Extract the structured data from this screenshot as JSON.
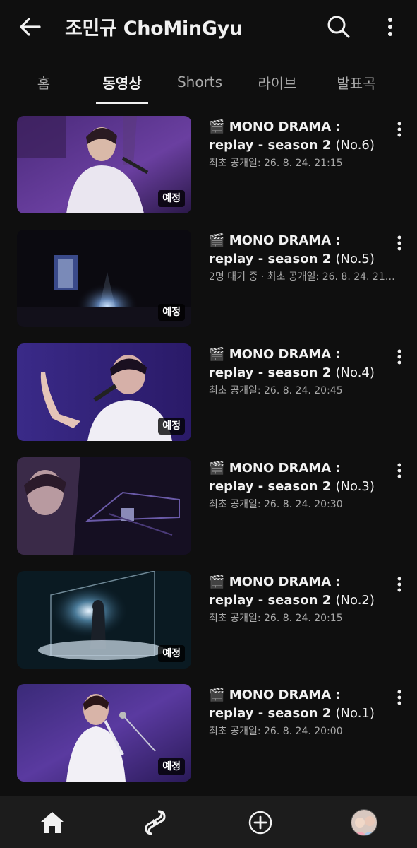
{
  "header": {
    "back_icon": "arrow-left-icon",
    "channel_name": "조민규 ChoMinGyu",
    "search_icon": "search-icon",
    "more_icon": "more-vert-icon"
  },
  "tabs": [
    {
      "label": "홈",
      "active": false
    },
    {
      "label": "동영상",
      "active": true
    },
    {
      "label": "Shorts",
      "active": false
    },
    {
      "label": "라이브",
      "active": false
    },
    {
      "label": "발표곡",
      "active": false
    }
  ],
  "videos": [
    {
      "emoji": "🎬",
      "title_main": "MONO DRAMA : replay - season 2",
      "title_num": "(No.6)",
      "meta": "최초 공개일: 26. 8. 24. 21:15",
      "badge": "예정"
    },
    {
      "emoji": "🎬",
      "title_main": "MONO DRAMA : replay - season 2",
      "title_num": "(No.5)",
      "meta": "2명 대기 중 · 최초 공개일: 26. 8. 24. 21…",
      "badge": "예정"
    },
    {
      "emoji": "🎬",
      "title_main": "MONO DRAMA : replay - season 2",
      "title_num": "(No.4)",
      "meta": "최초 공개일: 26. 8. 24. 20:45",
      "badge": "예정"
    },
    {
      "emoji": "🎬",
      "title_main": "MONO DRAMA : replay - season 2",
      "title_num": "(No.3)",
      "meta": "최초 공개일: 26. 8. 24. 20:30",
      "badge": ""
    },
    {
      "emoji": "🎬",
      "title_main": "MONO DRAMA : replay - season 2",
      "title_num": "(No.2)",
      "meta": "최초 공개일: 26. 8. 24. 20:15",
      "badge": "예정"
    },
    {
      "emoji": "🎬",
      "title_main": "MONO DRAMA : replay - season 2",
      "title_num": "(No.1)",
      "meta": "최초 공개일: 26. 8. 24. 20:00",
      "badge": "예정"
    }
  ],
  "bottom_nav": {
    "home_icon": "home-icon",
    "shorts_icon": "shorts-icon",
    "create_icon": "add-circle-icon",
    "profile_icon": "avatar"
  },
  "colors": {
    "background": "#0f0f0f",
    "text_primary": "#f1f1f1",
    "text_secondary": "#aaaaaa",
    "bottom_nav_bg": "#1c1c1c"
  }
}
